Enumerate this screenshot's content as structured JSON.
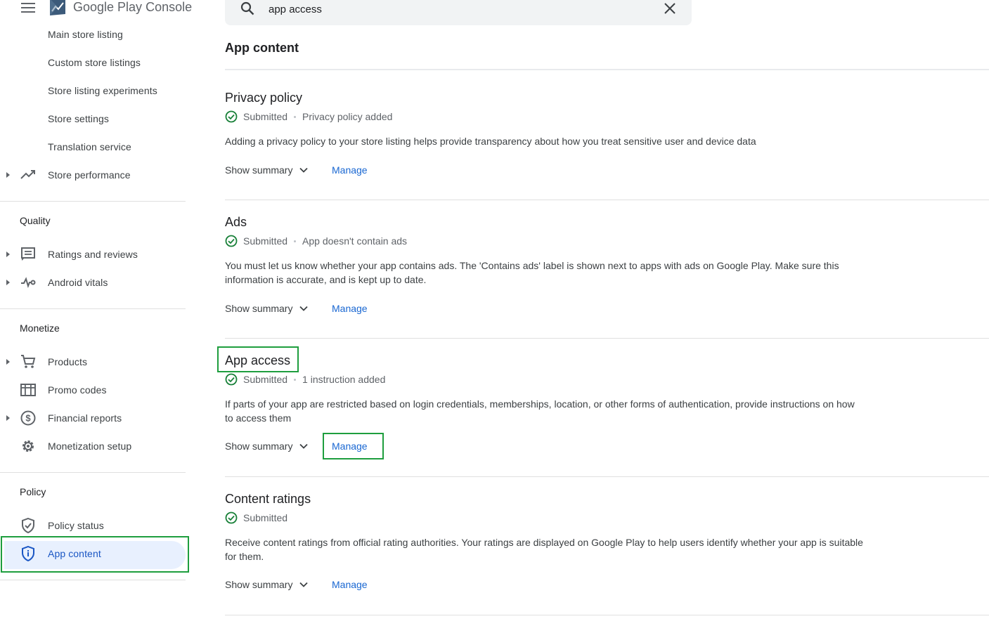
{
  "app": {
    "logo_brand": "Google Play",
    "logo_product": "Console"
  },
  "sidebar": {
    "store_items": [
      {
        "label": "Main store listing"
      },
      {
        "label": "Custom store listings"
      },
      {
        "label": "Store listing experiments"
      },
      {
        "label": "Store settings"
      },
      {
        "label": "Translation service"
      },
      {
        "label": "Store performance",
        "icon": "trending-up-icon"
      }
    ],
    "sections": {
      "quality": {
        "title": "Quality",
        "items": [
          {
            "label": "Ratings and reviews",
            "icon": "reviews-icon"
          },
          {
            "label": "Android vitals",
            "icon": "vitals-icon"
          }
        ]
      },
      "monetize": {
        "title": "Monetize",
        "items": [
          {
            "label": "Products",
            "icon": "cart-icon"
          },
          {
            "label": "Promo codes",
            "icon": "promo-icon"
          },
          {
            "label": "Financial reports",
            "icon": "dollar-icon"
          },
          {
            "label": "Monetization setup",
            "icon": "gear-icon"
          }
        ]
      },
      "policy": {
        "title": "Policy",
        "items": [
          {
            "label": "Policy status",
            "icon": "shield-check-icon"
          },
          {
            "label": "App content",
            "icon": "shield-info-icon",
            "active": true
          }
        ]
      }
    }
  },
  "search": {
    "value": "app access"
  },
  "main": {
    "page_title": "App content",
    "cards": [
      {
        "title": "Privacy policy",
        "status": "Submitted",
        "detail": "Privacy policy added",
        "description": "Adding a privacy policy to your store listing helps provide transparency about how you treat sensitive user and device data",
        "summary_label": "Show summary",
        "manage_label": "Manage"
      },
      {
        "title": "Ads",
        "status": "Submitted",
        "detail": "App doesn't contain ads",
        "description": "You must let us know whether your app contains ads. The 'Contains ads' label is shown next to apps with ads on Google Play. Make sure this information is accurate, and is kept up to date.",
        "summary_label": "Show summary",
        "manage_label": "Manage"
      },
      {
        "title": "App access",
        "status": "Submitted",
        "detail": "1 instruction added",
        "description": "If parts of your app are restricted based on login credentials, memberships, location, or other forms of authentication, provide instructions on how to access them",
        "summary_label": "Show summary",
        "manage_label": "Manage"
      },
      {
        "title": "Content ratings",
        "status": "Submitted",
        "detail": "",
        "description": "Receive content ratings from official rating authorities. Your ratings are displayed on Google Play to help users identify whether your app is suitable for them.",
        "summary_label": "Show summary",
        "manage_label": "Manage"
      }
    ]
  },
  "colors": {
    "accent": "#1967d2",
    "highlight": "#1e9e3e",
    "status_ok": "#188038",
    "active_bg": "#e8f0fe"
  }
}
